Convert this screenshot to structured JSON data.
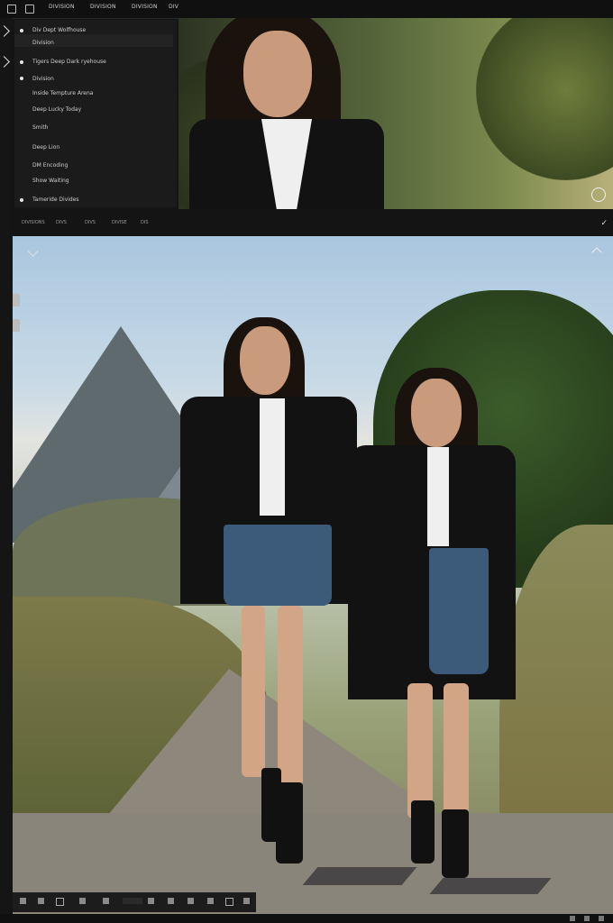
{
  "topbar": {
    "tabs": [
      "DIVISION",
      "DIVISION",
      "DIVISION",
      "DIV"
    ]
  },
  "panel": {
    "items": [
      "Div Dept Wolfhouse",
      "Division",
      "Tigers Deep Dark ryehouse",
      "Division",
      "Inside Tempture Arena",
      "Deep Lucky Today",
      "Smith",
      "Deep Lion",
      "DM Encoding",
      "Show Waiting",
      "Tameride Divides"
    ]
  },
  "midbar": {
    "tabs": [
      "DIVISIONS",
      "DIVS",
      "DIVS",
      "DIVISE",
      "DIS"
    ]
  },
  "icons": {
    "close": "circle-icon",
    "check": "check-icon"
  },
  "colors": {
    "background": "#141414",
    "panel": "#1b1b1b",
    "text": "#cfcfcf"
  }
}
